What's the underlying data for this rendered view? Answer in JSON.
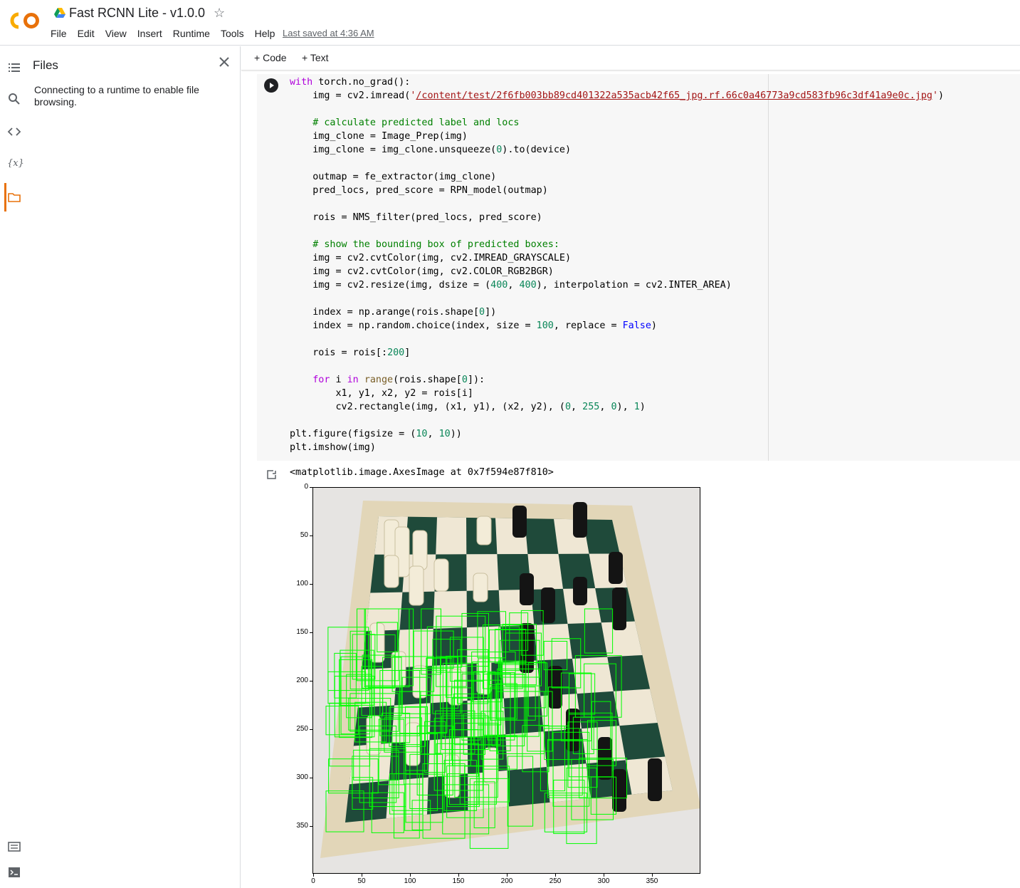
{
  "header": {
    "title": "Fast RCNN Lite - v1.0.0",
    "menu": [
      "File",
      "Edit",
      "View",
      "Insert",
      "Runtime",
      "Tools",
      "Help"
    ],
    "saved": "Last saved at 4:36 AM"
  },
  "files_panel": {
    "title": "Files",
    "message": "Connecting to a runtime to enable file browsing."
  },
  "toolbar": {
    "code_label": "Code",
    "text_label": "Text"
  },
  "output": {
    "text": "<matplotlib.image.AxesImage at 0x7f594e87f810>"
  },
  "plot": {
    "y_ticks": [
      "0",
      "50",
      "100",
      "150",
      "200",
      "250",
      "300",
      "350"
    ],
    "x_ticks": [
      "0",
      "50",
      "100",
      "150",
      "200",
      "250",
      "300",
      "350"
    ],
    "box_color": "#00ff00"
  },
  "colors": {
    "accent": "#e8710a",
    "keyword": "#af00db",
    "comment": "#008000",
    "string": "#a31515",
    "number": "#098658"
  }
}
